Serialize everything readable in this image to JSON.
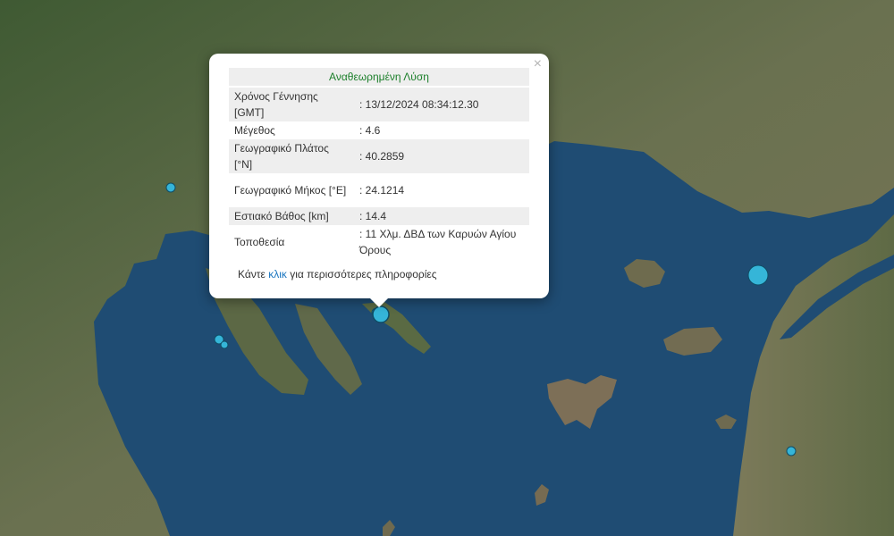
{
  "map": {
    "colors": {
      "sea": "#1f4c73",
      "land": "#556a3e"
    },
    "markers": [
      {
        "name": "epicenter-marker-selected",
        "lat": 40.2859,
        "lon": 24.1214,
        "magnitude": 4.6
      }
    ]
  },
  "popup": {
    "close_glyph": "×",
    "title": "Αναθεωρημένη Λύση",
    "rows": [
      {
        "label": "Χρόνος Γέννησης [GMT]",
        "value": ": 13/12/2024 08:34:12.30"
      },
      {
        "label": "Μέγεθος",
        "value": ": 4.6"
      },
      {
        "label": "Γεωγραφικό Πλάτος [°N]",
        "value": ": 40.2859"
      },
      {
        "label": "Γεωγραφικό Μήκος [°E]",
        "value": ": 24.1214"
      },
      {
        "label": "Εστιακό Βάθος [km]",
        "value": ": 14.4"
      },
      {
        "label": "Τοποθεσία",
        "value": ": 11 Χλμ. ΔΒΔ των Καρυών Αγίου Όρους"
      }
    ],
    "more_prefix": "Κάντε ",
    "more_link": "κλικ",
    "more_suffix": " για περισσότερες πληροφορίες"
  }
}
